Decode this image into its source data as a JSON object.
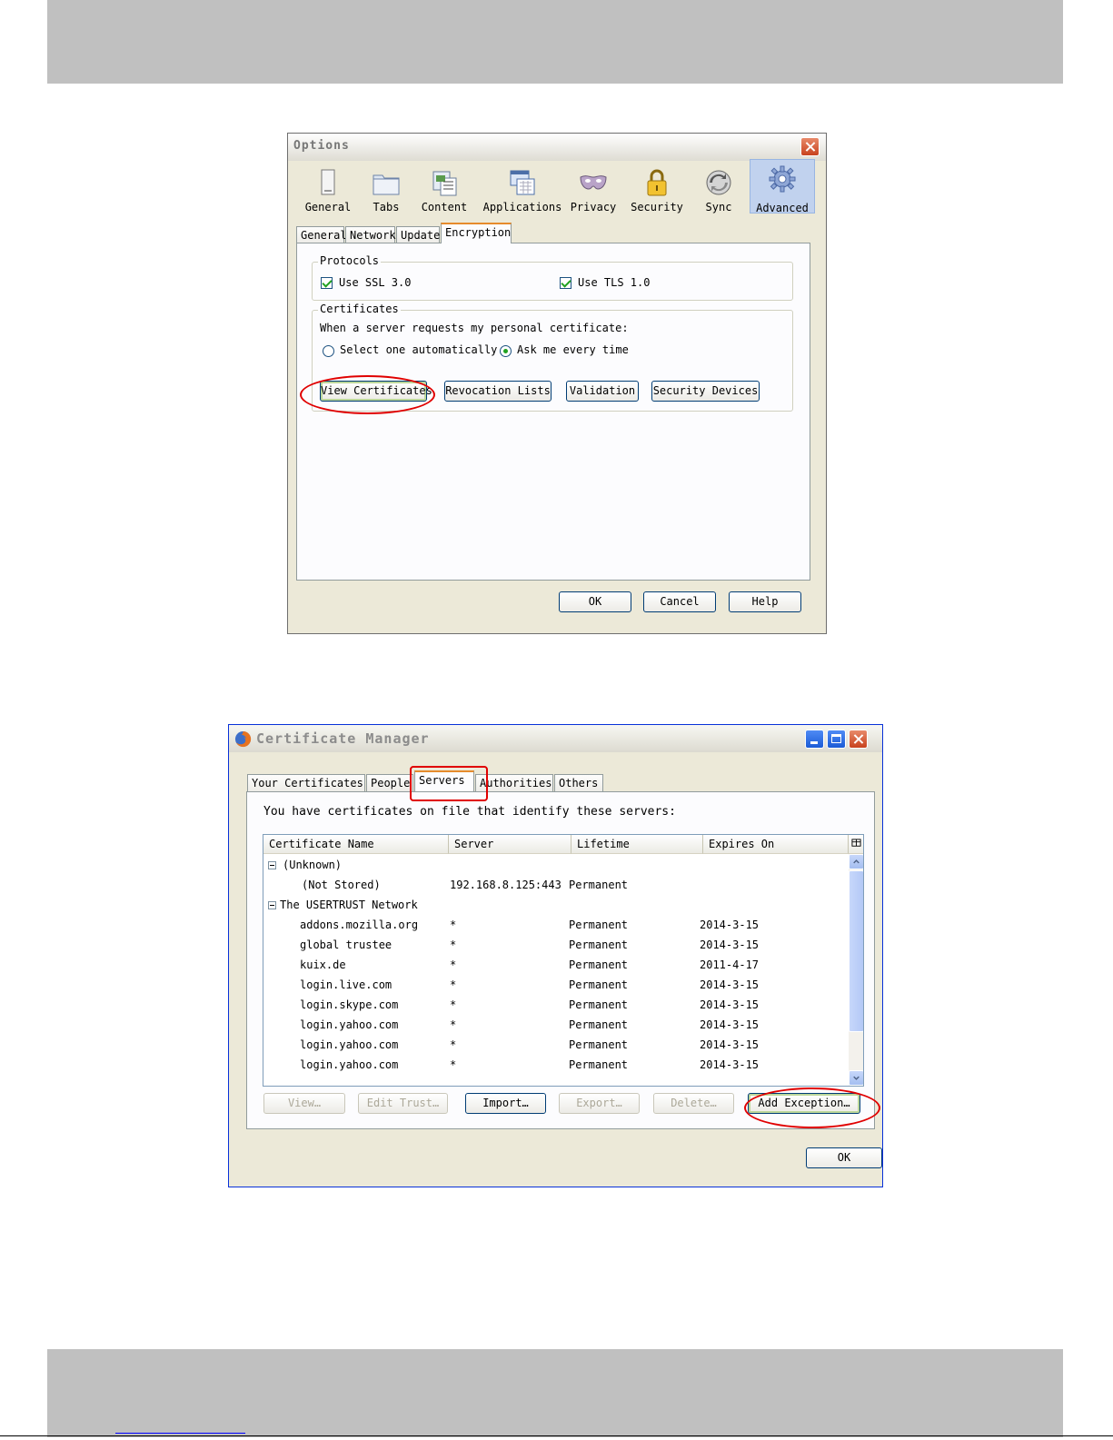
{
  "options": {
    "title": "Options",
    "toolbar": [
      {
        "label": "General",
        "icon": "general-icon"
      },
      {
        "label": "Tabs",
        "icon": "tabs-icon"
      },
      {
        "label": "Content",
        "icon": "content-icon"
      },
      {
        "label": "Applications",
        "icon": "applications-icon"
      },
      {
        "label": "Privacy",
        "icon": "privacy-mask-icon"
      },
      {
        "label": "Security",
        "icon": "padlock-icon"
      },
      {
        "label": "Sync",
        "icon": "sync-icon"
      },
      {
        "label": "Advanced",
        "icon": "gear-icon",
        "selected": true
      }
    ],
    "tabs": [
      "General",
      "Network",
      "Update",
      "Encryption"
    ],
    "active_tab": "Encryption",
    "protocols": {
      "label": "Protocols",
      "ssl": {
        "label": "Use SSL 3.0",
        "checked": true
      },
      "tls": {
        "label": "Use TLS 1.0",
        "checked": true
      }
    },
    "certificates": {
      "label": "Certificates",
      "prompt": "When a server requests my personal certificate:",
      "radio_auto": "Select one automatically",
      "radio_ask": "Ask me every time",
      "selected_radio": "Ask me every time",
      "buttons": {
        "view": "View Certificates",
        "revocation": "Revocation Lists",
        "validation": "Validation",
        "devices": "Security Devices"
      }
    },
    "footer": {
      "ok": "OK",
      "cancel": "Cancel",
      "help": "Help"
    }
  },
  "cert_manager": {
    "title": "Certificate Manager",
    "tabs": [
      "Your Certificates",
      "People",
      "Servers",
      "Authorities",
      "Others"
    ],
    "active_tab": "Servers",
    "intro": "You have certificates on file that identify these servers:",
    "columns": [
      "Certificate Name",
      "Server",
      "Lifetime",
      "Expires On"
    ],
    "groups": [
      {
        "name": "(Unknown)",
        "rows": [
          {
            "name": "(Not Stored)",
            "server": "192.168.8.125:443",
            "lifetime": "Permanent",
            "expires": ""
          }
        ]
      },
      {
        "name": "The USERTRUST Network",
        "rows": [
          {
            "name": "addons.mozilla.org",
            "server": "*",
            "lifetime": "Permanent",
            "expires": "2014-3-15"
          },
          {
            "name": "global trustee",
            "server": "*",
            "lifetime": "Permanent",
            "expires": "2014-3-15"
          },
          {
            "name": "kuix.de",
            "server": "*",
            "lifetime": "Permanent",
            "expires": "2011-4-17"
          },
          {
            "name": "login.live.com",
            "server": "*",
            "lifetime": "Permanent",
            "expires": "2014-3-15"
          },
          {
            "name": "login.skype.com",
            "server": "*",
            "lifetime": "Permanent",
            "expires": "2014-3-15"
          },
          {
            "name": "login.yahoo.com",
            "server": "*",
            "lifetime": "Permanent",
            "expires": "2014-3-15"
          },
          {
            "name": "login.yahoo.com",
            "server": "*",
            "lifetime": "Permanent",
            "expires": "2014-3-15"
          },
          {
            "name": "login.yahoo.com",
            "server": "*",
            "lifetime": "Permanent",
            "expires": "2014-3-15"
          }
        ]
      }
    ],
    "buttons": {
      "view": "View…",
      "edit_trust": "Edit Trust…",
      "import": "Import…",
      "export": "Export…",
      "delete": "Delete…",
      "add_exception": "Add Exception…"
    },
    "ok": "OK"
  },
  "colors": {
    "highlight_annotation": "#e00000",
    "selected_tab_accent": "#e68b2c",
    "window_face": "#ece9d8"
  }
}
